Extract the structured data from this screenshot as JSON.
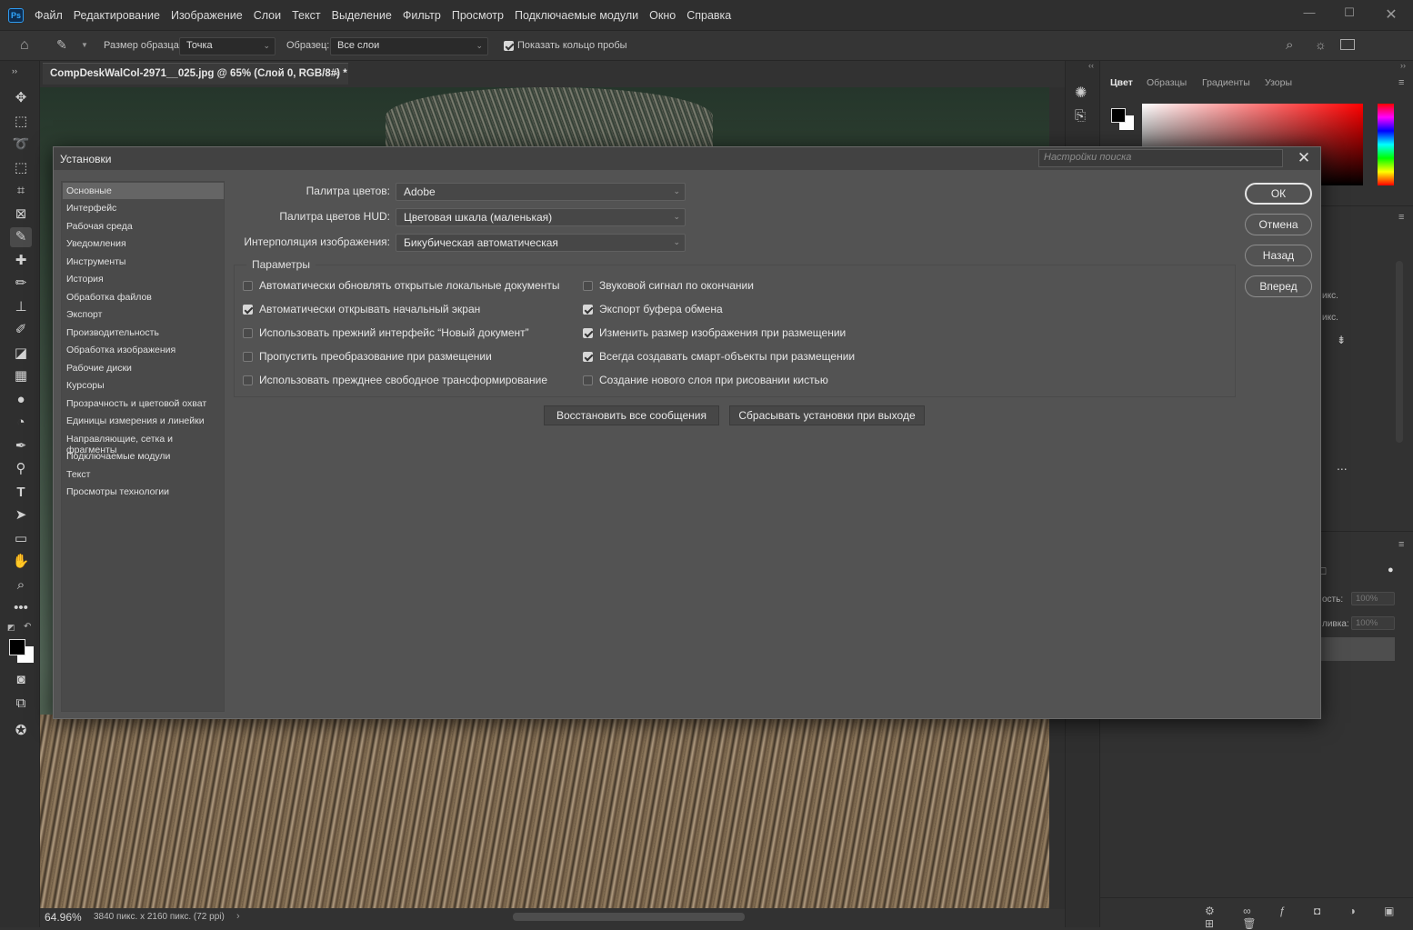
{
  "app": {
    "logo": "Ps",
    "menu": [
      "Файл",
      "Редактирование",
      "Изображение",
      "Слои",
      "Текст",
      "Выделение",
      "Фильтр",
      "Просмотр",
      "Подключаемые модули",
      "Окно",
      "Справка"
    ]
  },
  "options_bar": {
    "sample_size_label": "Размер образца:",
    "sample_size_value": "Точка",
    "sample_label": "Образец:",
    "sample_value": "Все слои",
    "show_ring_label": "Показать кольцо пробы",
    "show_ring_checked": true
  },
  "document": {
    "tab_title": "CompDeskWalCol-2971__025.jpg @ 65% (Слой 0, RGB/8#) *",
    "zoom": "64.96%",
    "info": "3840 пикс. x 2160 пикс. (72 ppi)"
  },
  "panels": {
    "color_tabs": [
      "Цвет",
      "Образцы",
      "Градиенты",
      "Узоры"
    ],
    "ghost_texts": [
      "икс.",
      "икс.",
      "ость:",
      "ливка:"
    ],
    "ghost_values": [
      "100%",
      "100%"
    ],
    "more": "..."
  },
  "dialog": {
    "title": "Установки",
    "search_placeholder": "Настройки поиска",
    "nav": [
      "Основные",
      "Интерфейс",
      "Рабочая среда",
      "Уведомления",
      "Инструменты",
      "История",
      "Обработка файлов",
      "Экспорт",
      "Производительность",
      "Обработка изображения",
      "Рабочие диски",
      "Курсоры",
      "Прозрачность и цветовой охват",
      "Единицы измерения и линейки",
      "Направляющие, сетка и фрагменты",
      "Подключаемые модули",
      "Текст",
      "Просмотры технологии"
    ],
    "fields": [
      {
        "label": "Палитра цветов:",
        "value": "Adobe"
      },
      {
        "label": "Палитра цветов HUD:",
        "value": "Цветовая шкала (маленькая)"
      },
      {
        "label": "Интерполяция изображения:",
        "value": "Бикубическая автоматическая"
      }
    ],
    "params_title": "Параметры",
    "options_left": [
      {
        "label": "Автоматически обновлять открытые локальные документы",
        "checked": false
      },
      {
        "label": "Автоматически открывать начальный экран",
        "checked": true
      },
      {
        "label": "Использовать прежний интерфейс “Новый документ”",
        "checked": false
      },
      {
        "label": "Пропустить преобразование при размещении",
        "checked": false
      },
      {
        "label": "Использовать прежднее свободное трансформирование",
        "checked": false
      }
    ],
    "options_right": [
      {
        "label": "Звуковой сигнал по окончании",
        "checked": false
      },
      {
        "label": "Экспорт буфера обмена",
        "checked": true
      },
      {
        "label": "Изменить размер изображения при размещении",
        "checked": true
      },
      {
        "label": "Всегда создавать смарт-объекты при размещении",
        "checked": true
      },
      {
        "label": "Создание нового слоя при рисовании кистью",
        "checked": false
      }
    ],
    "restore_button": "Восстановить все сообщения",
    "reset_button": "Сбрасывать установки при выходе",
    "ok": "ОК",
    "cancel": "Отмена",
    "back": "Назад",
    "forward": "Вперед"
  }
}
